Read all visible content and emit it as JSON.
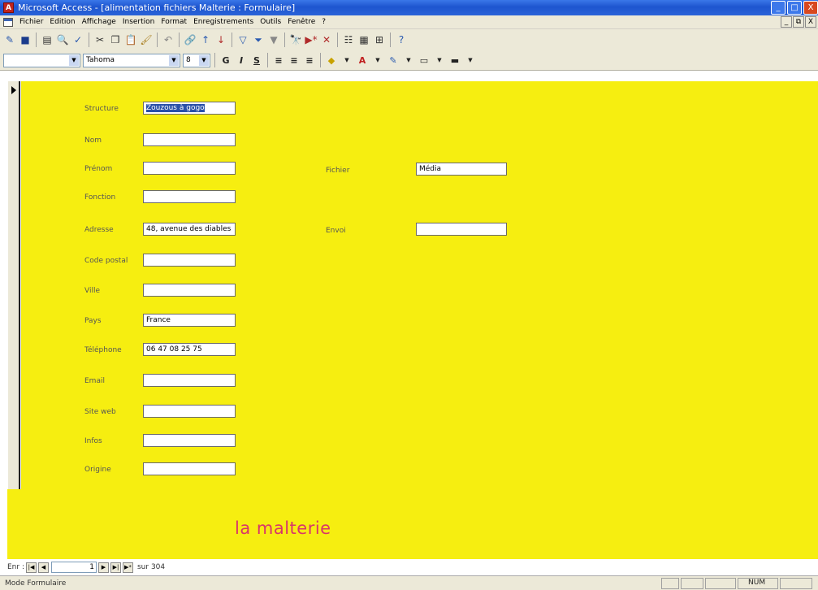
{
  "window": {
    "title": "Microsoft Access - [alimentation fichiers Malterie : Formulaire]",
    "app_icon_glyph": "A",
    "buttons": {
      "minimize": "_",
      "maximize": "□",
      "close": "X"
    }
  },
  "menu": {
    "items": [
      "Fichier",
      "Edition",
      "Affichage",
      "Insertion",
      "Format",
      "Enregistrements",
      "Outils",
      "Fenêtre",
      "?"
    ],
    "mdi_buttons": {
      "minimize": "_",
      "restore": "⧉",
      "close": "X"
    }
  },
  "format_toolbar": {
    "object_combo": "",
    "font_combo": "Tahoma",
    "size_combo": "8"
  },
  "form": {
    "fields_left": [
      {
        "label": "Structure",
        "value": "Zouzous à gogo",
        "selected": true
      },
      {
        "label": "Nom",
        "value": ""
      },
      {
        "label": "Prénom",
        "value": ""
      },
      {
        "label": "Fonction",
        "value": ""
      },
      {
        "label": "Adresse",
        "value": "48, avenue des diables"
      },
      {
        "label": "Code postal",
        "value": ""
      },
      {
        "label": "Ville",
        "value": ""
      },
      {
        "label": "Pays",
        "value": "France"
      },
      {
        "label": "Téléphone",
        "value": "06 47 08 25 75"
      },
      {
        "label": "Email",
        "value": ""
      },
      {
        "label": "Site web",
        "value": ""
      },
      {
        "label": "Infos",
        "value": ""
      },
      {
        "label": "Origine",
        "value": ""
      }
    ],
    "fields_right": [
      {
        "label": "Fichier",
        "value": "Média"
      },
      {
        "label": "Envoi",
        "value": ""
      }
    ],
    "brand": "la malterie",
    "background_color": "#f6ee10"
  },
  "navigation": {
    "label": "Enr :",
    "current": "1",
    "count": "sur 304"
  },
  "status": {
    "text": "Mode Formulaire",
    "num": "NUM"
  }
}
